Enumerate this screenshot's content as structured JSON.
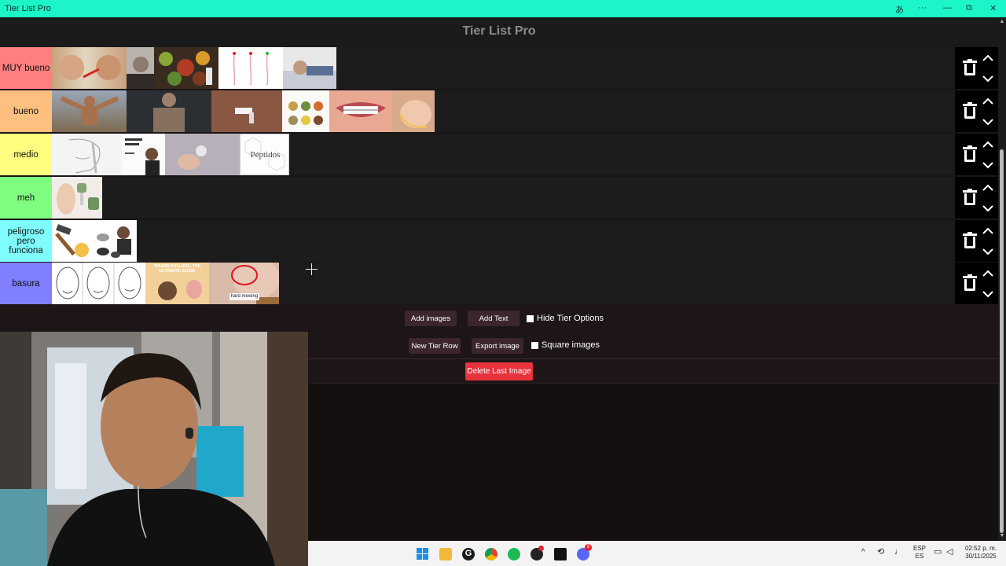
{
  "window": {
    "title": "Tier List Pro",
    "titlebar_color": "#1cf5c8"
  },
  "app": {
    "title": "Tier List Pro"
  },
  "tiers": [
    {
      "label": "MUY bueno",
      "color": "#ff7f7f"
    },
    {
      "label": "bueno",
      "color": "#ffbf7f"
    },
    {
      "label": "medio",
      "color": "#ffff7f"
    },
    {
      "label": "meh",
      "color": "#7fff7f"
    },
    {
      "label": "peligroso pero funciona",
      "color": "#7fffff"
    },
    {
      "label": "basura",
      "color": "#7f7fff"
    }
  ],
  "thumbnail_texts": {
    "peptidos": "Péptidos",
    "thumb_pulling": "THUMB PULLING: THE ULTIMATE GUIDE",
    "hard_mewing": "hard mewing"
  },
  "controls": {
    "add_images": "Add images",
    "add_text": "Add Text",
    "hide_tier_options": "Hide Tier Options",
    "new_tier_row": "New Tier Row",
    "export_image": "Export image",
    "square_images": "Square images",
    "delete_last_image": "Delete Last Image"
  },
  "taskbar": {
    "lang_top": "ESP",
    "lang_bottom": "ES",
    "time": "02:52 p. m.",
    "date": "30/11/2025",
    "discord_badge": "8"
  },
  "accent_delete": "#e8323c"
}
